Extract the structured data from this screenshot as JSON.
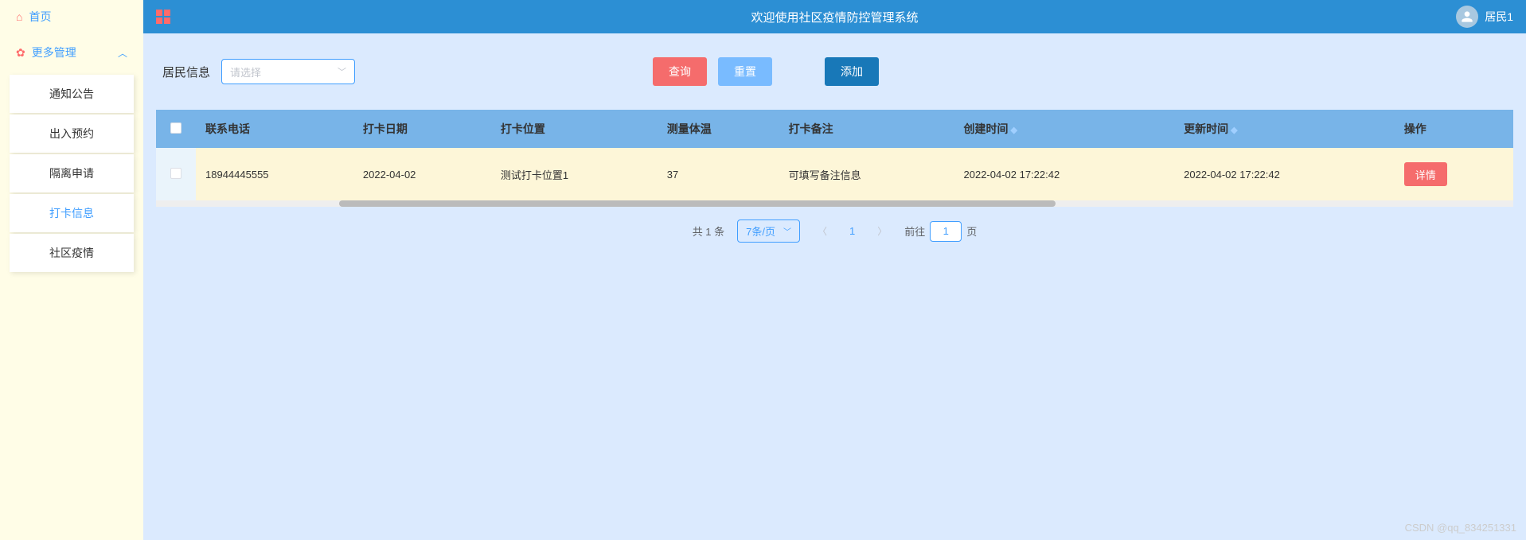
{
  "sidebar": {
    "home": "首页",
    "more": "更多管理",
    "items": [
      {
        "label": "通知公告"
      },
      {
        "label": "出入预约"
      },
      {
        "label": "隔离申请"
      },
      {
        "label": "打卡信息"
      },
      {
        "label": "社区疫情"
      }
    ]
  },
  "topbar": {
    "title": "欢迎使用社区疫情防控管理系统",
    "username": "居民1"
  },
  "filter": {
    "label": "居民信息",
    "placeholder": "请选择",
    "search_btn": "查询",
    "reset_btn": "重置",
    "add_btn": "添加"
  },
  "table": {
    "headers": {
      "phone": "联系电话",
      "date": "打卡日期",
      "location": "打卡位置",
      "temp": "测量体温",
      "remark": "打卡备注",
      "created": "创建时间",
      "updated": "更新时间",
      "action": "操作"
    },
    "rows": [
      {
        "phone": "18944445555",
        "date": "2022-04-02",
        "location": "测试打卡位置1",
        "temp": "37",
        "remark": "可填写备注信息",
        "created": "2022-04-02 17:22:42",
        "updated": "2022-04-02 17:22:42",
        "detail_btn": "详情"
      }
    ]
  },
  "pagination": {
    "total": "共 1 条",
    "page_size": "7条/页",
    "current": "1",
    "goto_prefix": "前往",
    "goto_value": "1",
    "goto_suffix": "页"
  },
  "watermark": "CSDN @qq_834251331"
}
